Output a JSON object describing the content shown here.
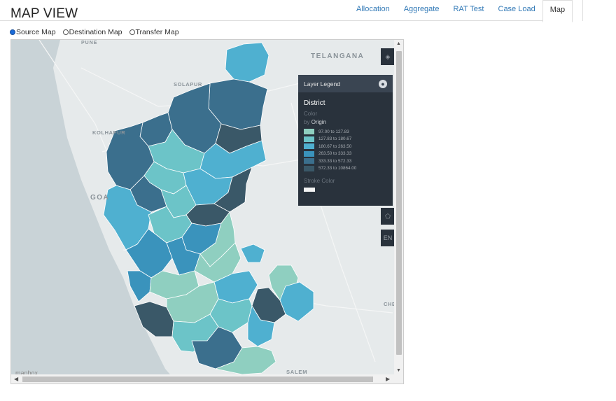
{
  "header": {
    "title": "MAP VIEW"
  },
  "tabs": [
    {
      "label": "Allocation",
      "active": false
    },
    {
      "label": "Aggregate",
      "active": false
    },
    {
      "label": "RAT Test",
      "active": false
    },
    {
      "label": "Case Load",
      "active": false
    },
    {
      "label": "Map",
      "active": true
    }
  ],
  "map_type": {
    "options": [
      {
        "label": "Source Map",
        "checked": true
      },
      {
        "label": "Destination Map",
        "checked": false
      },
      {
        "label": "Transfer Map",
        "checked": false
      }
    ]
  },
  "map": {
    "place_labels": [
      "TELANGANA",
      "PUNE",
      "SOLAPUR",
      "KOLHAPUR",
      "GOA",
      "CHE",
      "SALEM"
    ],
    "attribution": "mapbox",
    "controls": {
      "layer_icon": "layers-icon",
      "draw_icon": "polygon-draw-icon",
      "lang_label": "EN"
    }
  },
  "legend": {
    "header": "Layer Legend",
    "layer_name": "District",
    "color_label": "Color",
    "by_prefix": "by",
    "by_field": "Origin",
    "stroke_label": "Stroke Color",
    "bins": [
      {
        "range": "97.00 to 127.83",
        "color": "#8fcfc0"
      },
      {
        "range": "127.83 to 180.67",
        "color": "#6cc4c8"
      },
      {
        "range": "180.67 to 263.50",
        "color": "#4fb0d0"
      },
      {
        "range": "263.50 to 333.33",
        "color": "#3a93bc"
      },
      {
        "range": "333.33 to 572.33",
        "color": "#3b6f8d"
      },
      {
        "range": "572.33 to 10864.00",
        "color": "#3a5868"
      }
    ]
  }
}
